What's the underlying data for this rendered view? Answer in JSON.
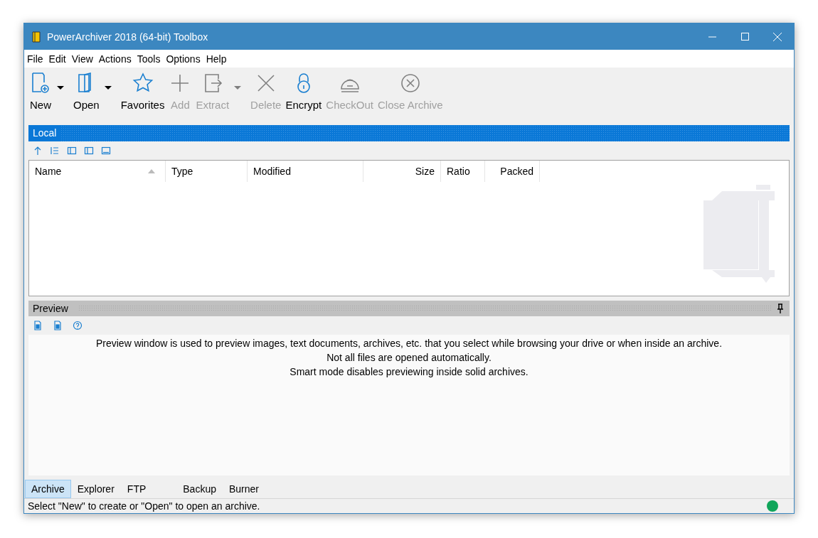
{
  "window": {
    "title": "PowerArchiver 2018 (64-bit) Toolbox"
  },
  "menu": [
    "File",
    "Edit",
    "View",
    "Actions",
    "Tools",
    "Options",
    "Help"
  ],
  "toolbar": [
    {
      "kind": "new",
      "label": "New",
      "disabled": false,
      "dropdown": true
    },
    {
      "kind": "open",
      "label": "Open",
      "disabled": false,
      "dropdown": true
    },
    {
      "kind": "favorites",
      "label": "Favorites",
      "disabled": false,
      "dropdown": false
    },
    {
      "kind": "add",
      "label": "Add",
      "disabled": true,
      "dropdown": false
    },
    {
      "kind": "extract",
      "label": "Extract",
      "disabled": true,
      "dropdown": true
    },
    {
      "kind": "delete",
      "label": "Delete",
      "disabled": true,
      "dropdown": false
    },
    {
      "kind": "encrypt",
      "label": "Encrypt",
      "disabled": false,
      "dropdown": false
    },
    {
      "kind": "checkout",
      "label": "CheckOut",
      "disabled": true,
      "dropdown": false
    },
    {
      "kind": "close",
      "label": "Close Archive",
      "disabled": true,
      "dropdown": false
    }
  ],
  "local_panel": {
    "title": "Local"
  },
  "table": {
    "columns": [
      {
        "label": "Name",
        "sorted": true
      },
      {
        "label": "Type",
        "sorted": false
      },
      {
        "label": "Modified",
        "sorted": false
      },
      {
        "label": "Size",
        "sorted": false
      },
      {
        "label": "Ratio",
        "sorted": false
      },
      {
        "label": "Packed",
        "sorted": false
      }
    ]
  },
  "preview": {
    "title": "Preview",
    "lines": [
      "Preview window is used to preview images, text documents, archives, etc. that you select while browsing your drive or when inside an archive.",
      "Not all files are opened automatically.",
      "Smart mode disables previewing inside solid archives."
    ]
  },
  "tabs": [
    {
      "label": "Archive",
      "selected": true
    },
    {
      "label": "Explorer",
      "selected": false
    },
    {
      "label": "FTP",
      "selected": false
    },
    {
      "label": "Backup",
      "selected": false
    },
    {
      "label": "Burner",
      "selected": false
    }
  ],
  "status_bar": {
    "text": "Select \"New\" to create or \"Open\" to open an archive."
  }
}
